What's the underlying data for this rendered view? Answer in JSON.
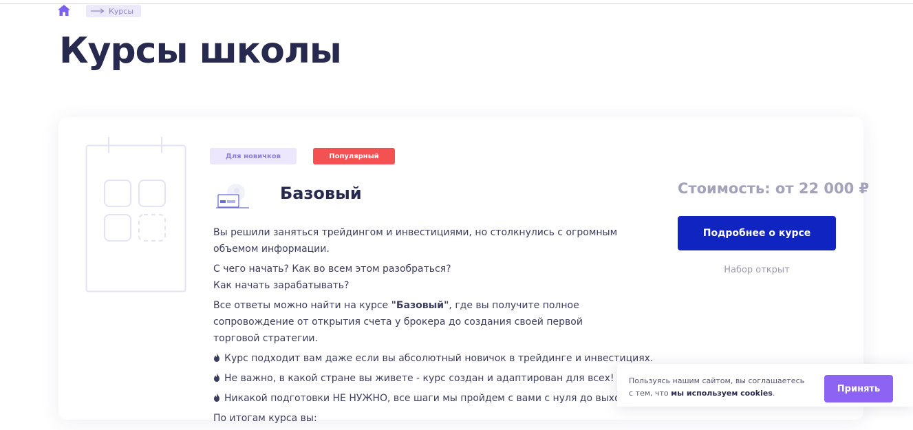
{
  "breadcrumb": {
    "home_icon": "home-icon",
    "arrow_icon": "long-arrow-right-icon",
    "current": "Курсы"
  },
  "page_title": "Курсы школы",
  "course": {
    "badges": [
      "Для новичков",
      "Популярный"
    ],
    "title": "Базовый",
    "illustration_icon": "calendar-grid-icon",
    "course_icon": "laptop-chart-icon",
    "description": {
      "p1": "Вы решили заняться трейдингом и инвестициями, но столкнулись с огромным объемом информации.",
      "p2_line1": "С чего начать? Как во всем этом разобраться?",
      "p2_line2": "Как начать зарабатывать?",
      "p3_before": "Все ответы можно найти на курсе ",
      "p3_bold": "\"Базовый\"",
      "p3_after": ", где вы получите полное сопровождение от открытия счета у брокера до создания своей первой торговой стратегии.",
      "bullets": [
        "Курс подходит вам даже если вы абсолютный новичок в трейдинге и инвестициях.",
        "Не важно, в какой стране вы живете - курс создан и адаптирован для всех!",
        "Никакой подготовки НЕ НУЖНО, все шаги мы пройдем с вами с нуля до выхода на"
      ],
      "bullet_icon": "fire-icon",
      "outcome_heading": "По итогам курса вы:"
    },
    "price": "Стоимость: от 22 000 ₽",
    "details_button": "Подробнее о курсе",
    "enrollment_status": "Набор открыт"
  },
  "cookie_banner": {
    "text": "Пользуясь нашим сайтом, вы соглашаетесь с тем, что ",
    "link": "мы используем cookies",
    "text_end": ".",
    "accept_button": "Принять"
  },
  "colors": {
    "title": "#272a4e",
    "primary_button": "#0f24c1",
    "popular_badge": "#f45252",
    "beginner_badge_bg": "#ece7fd",
    "accept_button": "#8c63f3",
    "price": "#a2a2ba"
  }
}
